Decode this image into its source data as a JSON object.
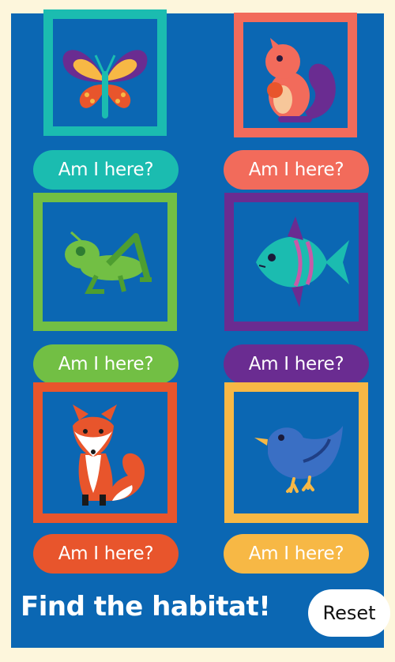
{
  "colors": {
    "background": "#fdf6dc",
    "panel": "#0b67b3",
    "teal": "#1bbcb0",
    "coral": "#f26b5b",
    "green": "#72bf44",
    "purple": "#6a2c91",
    "orange": "#e8552c",
    "yellow": "#f7b845"
  },
  "cards": [
    {
      "animal_icon": "butterfly-icon",
      "button_label": "Am I here?"
    },
    {
      "animal_icon": "squirrel-icon",
      "button_label": "Am I here?"
    },
    {
      "animal_icon": "grasshopper-icon",
      "button_label": "Am I here?"
    },
    {
      "animal_icon": "fish-icon",
      "button_label": "Am I here?"
    },
    {
      "animal_icon": "fox-icon",
      "button_label": "Am I here?"
    },
    {
      "animal_icon": "bird-icon",
      "button_label": "Am I here?"
    }
  ],
  "footer": {
    "title": "Find the habitat!",
    "reset_label": "Reset"
  }
}
